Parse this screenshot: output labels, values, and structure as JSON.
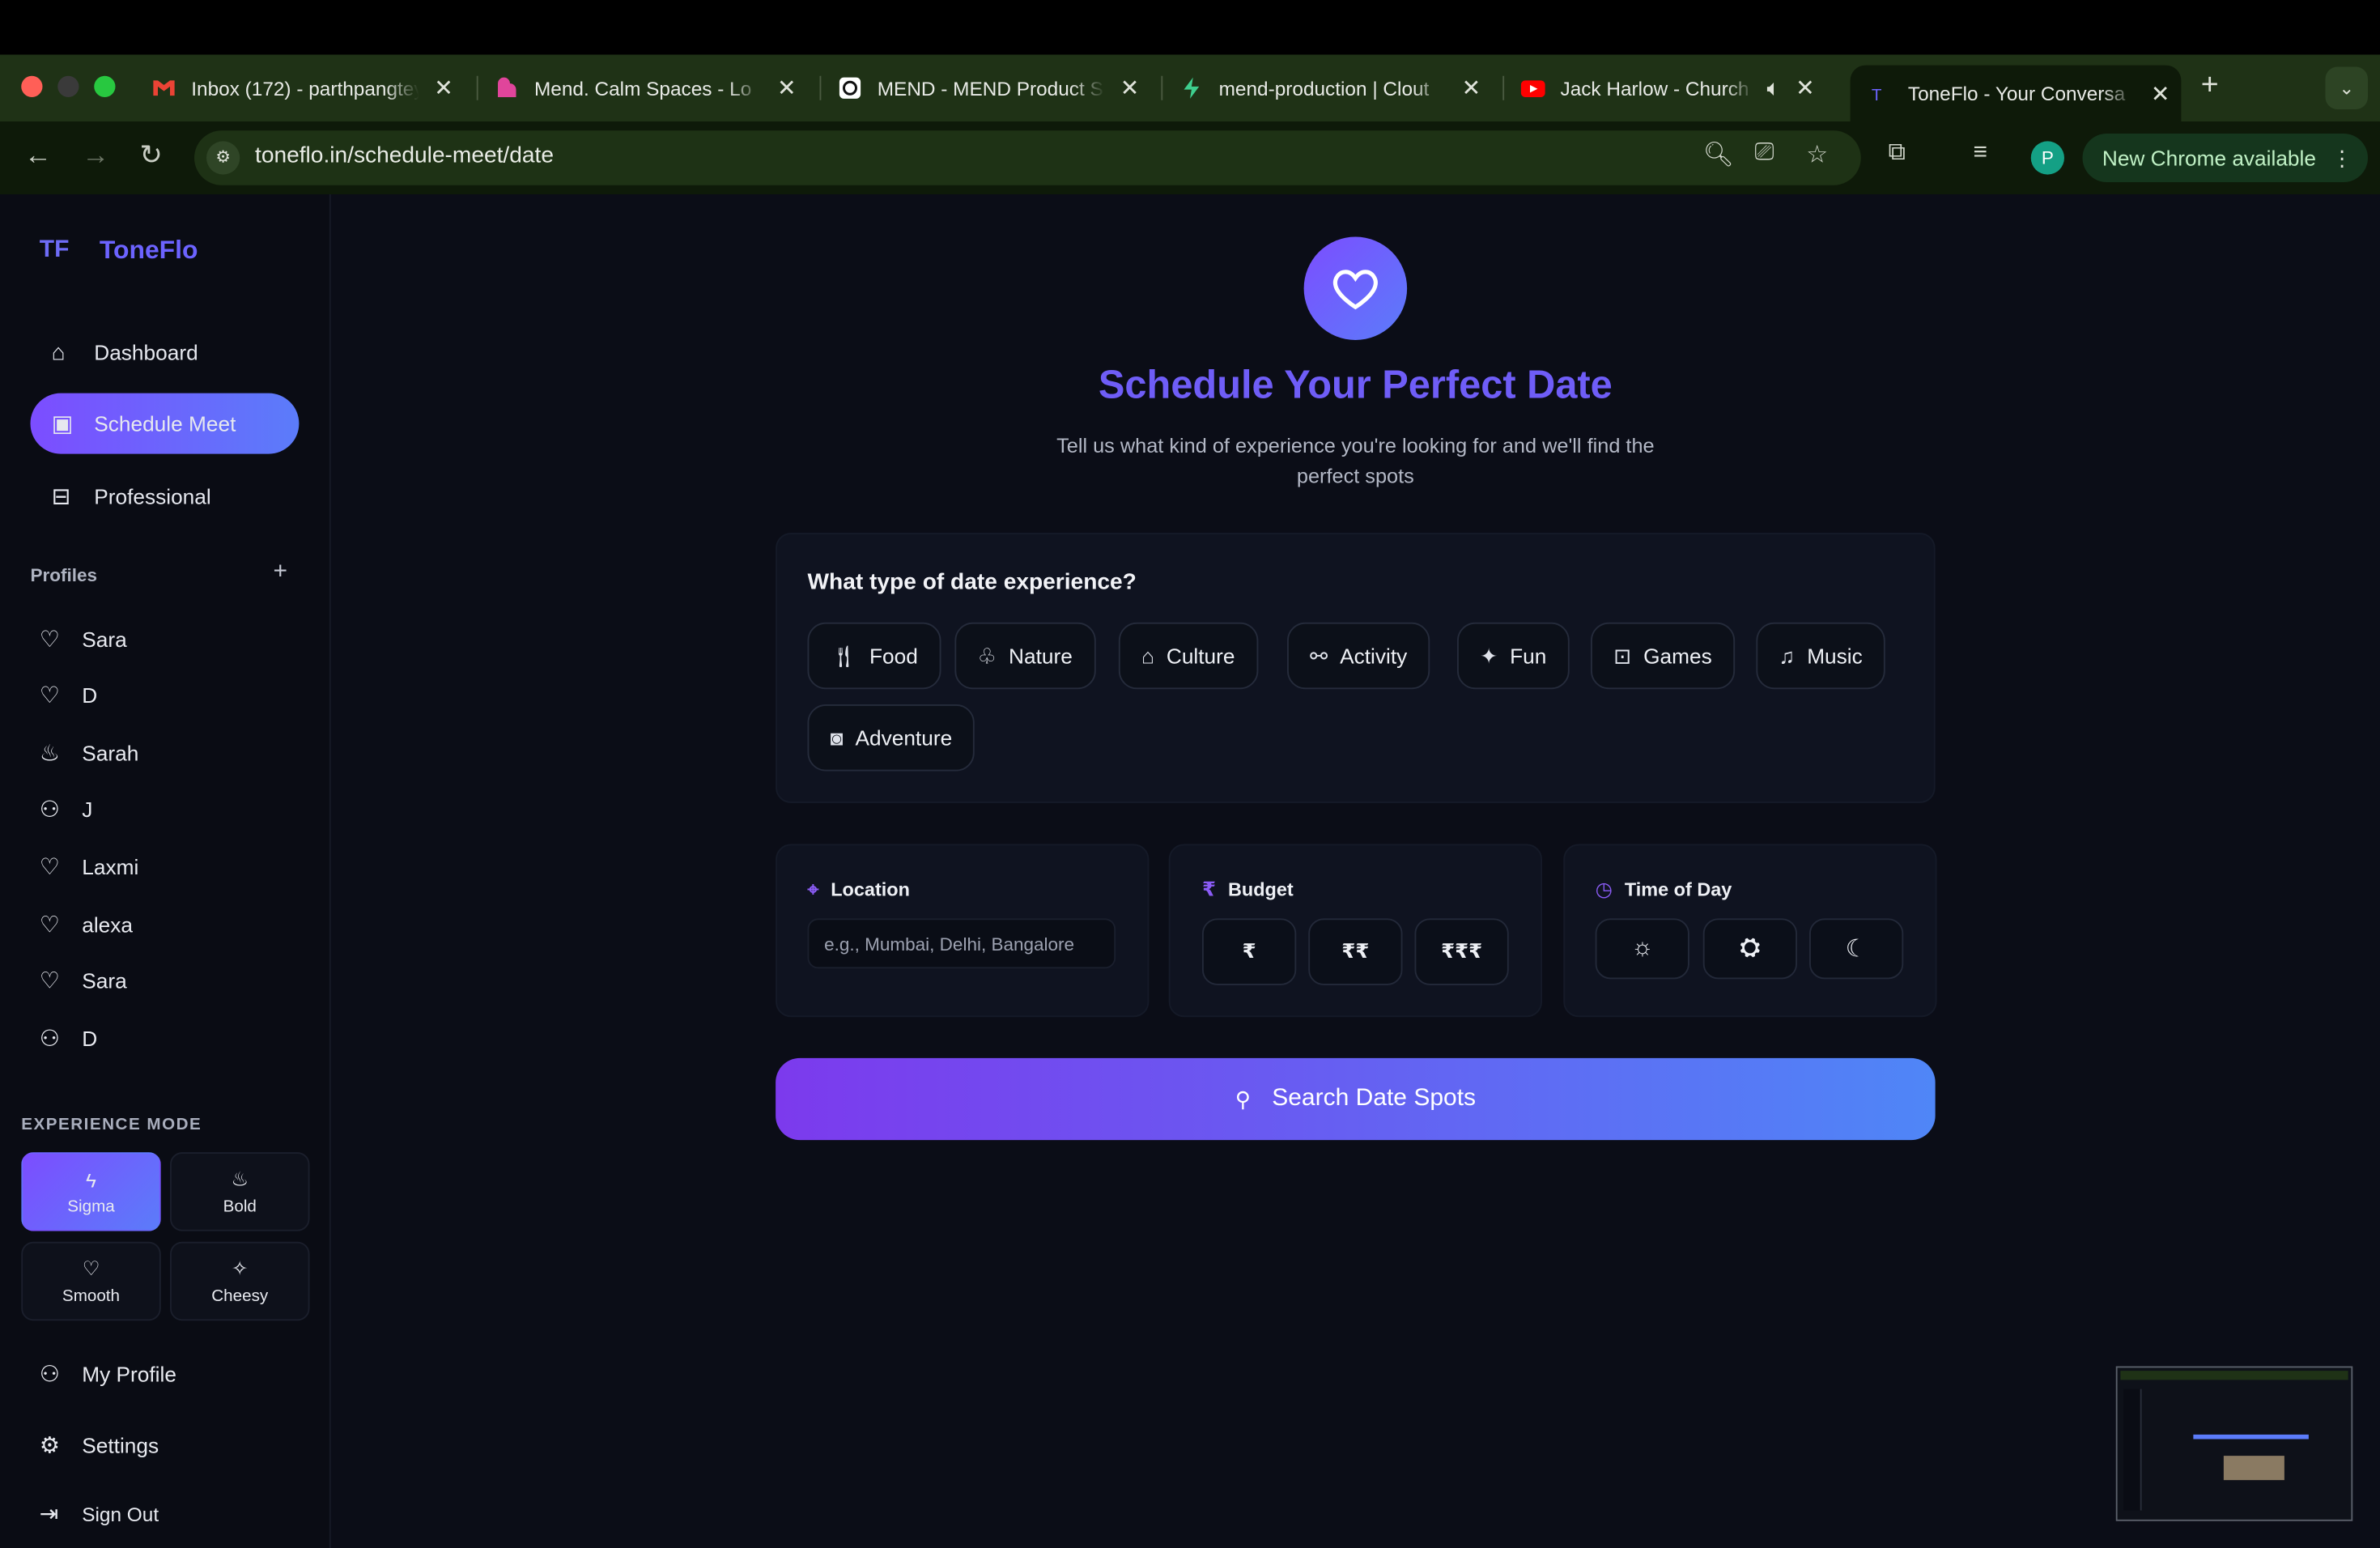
{
  "browser": {
    "tabs": [
      {
        "title": "Inbox (172) - parthpangtey",
        "icon": "gmail-icon",
        "color": "#ea4335"
      },
      {
        "title": "Mend. Calm Spaces - Lo",
        "icon": "mend-icon",
        "color": "#d946ef"
      },
      {
        "title": "MEND - MEND Product S",
        "icon": "openai-icon",
        "color": "#ffffff"
      },
      {
        "title": "mend-production | Clout",
        "icon": "bolt-icon",
        "color": "#3ecf8e"
      },
      {
        "title": "Jack Harlow - Church",
        "icon": "youtube-icon",
        "color": "#ff0000"
      },
      {
        "title": "ToneFlo - Your Conversa",
        "icon": "toneflo-icon",
        "color": "#6c63ff"
      }
    ],
    "url": "toneflo.in/schedule-meet/date",
    "profile_initial": "P",
    "update_label": "New Chrome available"
  },
  "app": {
    "brand": "ToneFlo",
    "accent": "#6c63ff",
    "nav": [
      {
        "label": "Dashboard",
        "icon": "home-icon"
      },
      {
        "label": "Schedule Meet",
        "icon": "calendar-icon"
      },
      {
        "label": "Professional",
        "icon": "briefcase-icon"
      }
    ],
    "profiles_heading": "Profiles",
    "profiles": [
      {
        "name": "Sara",
        "icon": "heart-icon"
      },
      {
        "name": "D",
        "icon": "heart-icon"
      },
      {
        "name": "Sarah",
        "icon": "flame-icon"
      },
      {
        "name": "J",
        "icon": "user-icon"
      },
      {
        "name": "Laxmi",
        "icon": "heart-icon"
      },
      {
        "name": "alexa",
        "icon": "heart-icon"
      },
      {
        "name": "Sara",
        "icon": "heart-icon"
      },
      {
        "name": "D",
        "icon": "user-icon"
      }
    ],
    "experience_heading": "EXPERIENCE MODE",
    "modes": [
      {
        "label": "Sigma",
        "icon": "bolt-icon",
        "active": true
      },
      {
        "label": "Bold",
        "icon": "flame-icon",
        "active": false
      },
      {
        "label": "Smooth",
        "icon": "heart-icon",
        "active": false
      },
      {
        "label": "Cheesy",
        "icon": "sparkles-icon",
        "active": false
      }
    ],
    "footer": [
      {
        "label": "My Profile",
        "icon": "user-icon"
      },
      {
        "label": "Settings",
        "icon": "gear-icon"
      },
      {
        "label": "Sign Out",
        "icon": "sign-out-icon"
      }
    ]
  },
  "main": {
    "title": "Schedule Your Perfect Date",
    "subtitle": "Tell us what kind of experience you're looking for and we'll find the perfect spots",
    "question": "What type of date experience?",
    "categories": [
      {
        "label": "Food",
        "icon": "utensils-icon"
      },
      {
        "label": "Nature",
        "icon": "tree-icon"
      },
      {
        "label": "Culture",
        "icon": "landmark-icon"
      },
      {
        "label": "Activity",
        "icon": "activity-icon"
      },
      {
        "label": "Fun",
        "icon": "party-icon"
      },
      {
        "label": "Games",
        "icon": "gamepad-icon"
      },
      {
        "label": "Music",
        "icon": "music-icon"
      },
      {
        "label": "Adventure",
        "icon": "camera-icon"
      }
    ],
    "location": {
      "label": "Location",
      "placeholder": "e.g., Mumbai, Delhi, Bangalore",
      "value": ""
    },
    "budget": {
      "label": "Budget",
      "options": [
        "₹",
        "₹₹",
        "₹₹₹"
      ]
    },
    "time_of_day": {
      "label": "Time of Day",
      "options": [
        "sun-icon",
        "sunset-icon",
        "moon-icon"
      ]
    },
    "search_label": "Search Date Spots"
  }
}
